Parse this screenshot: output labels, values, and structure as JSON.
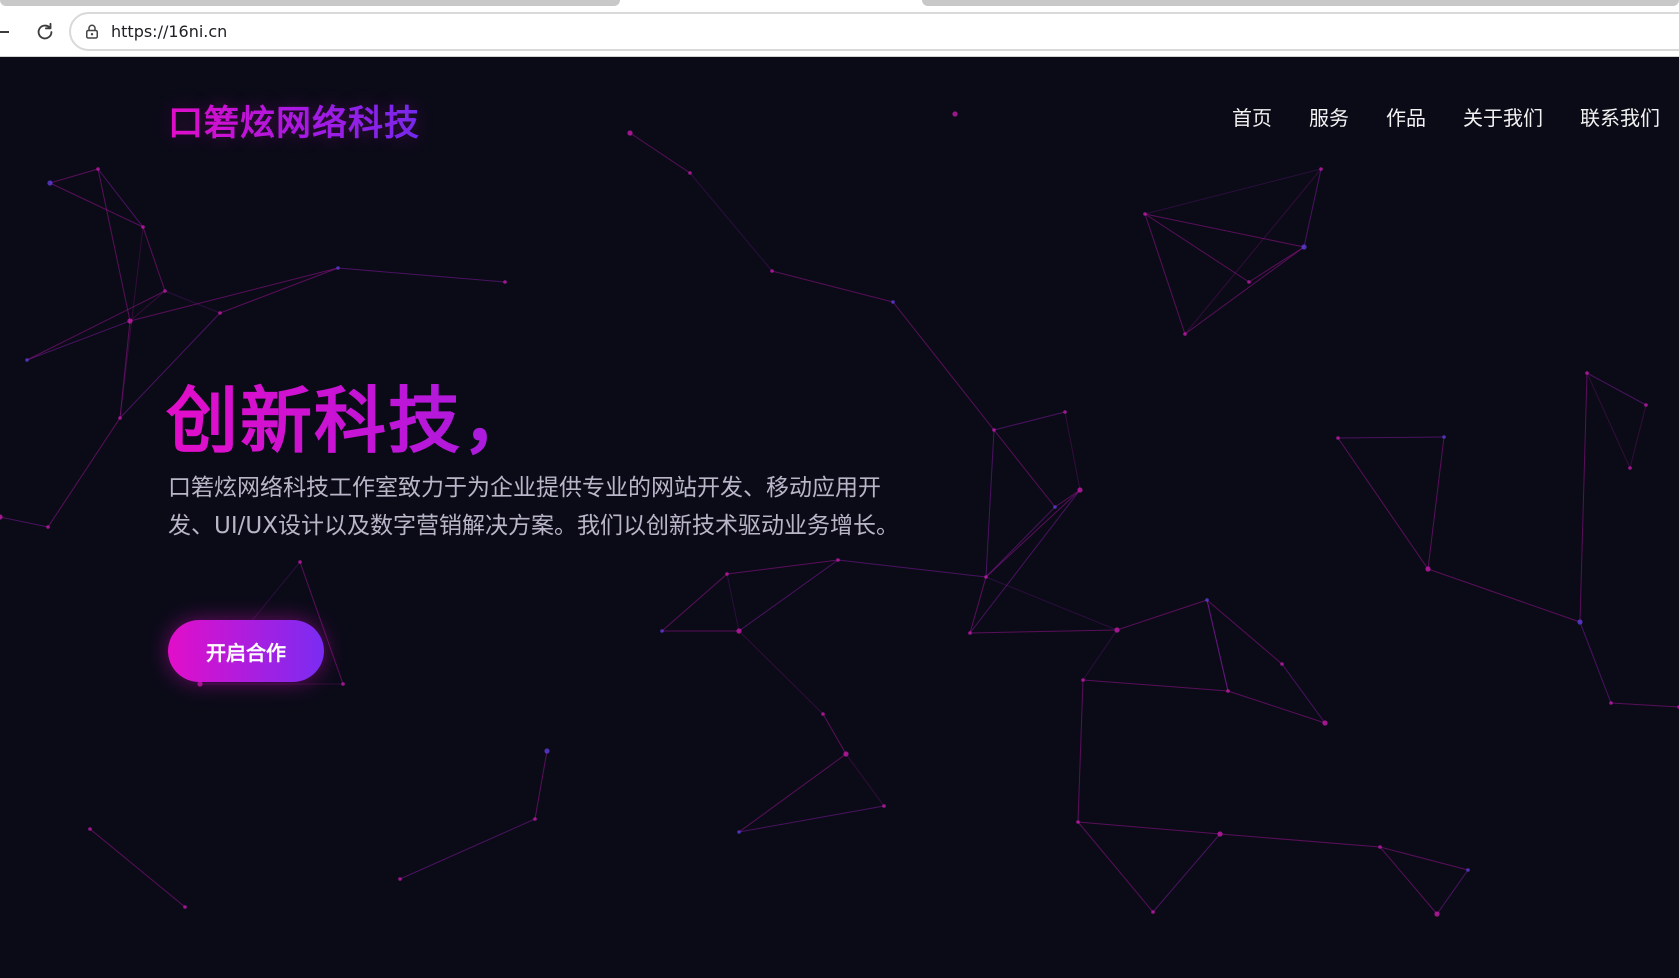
{
  "browser": {
    "url": "https://16ni.cn"
  },
  "site": {
    "brand": "口箬炫网络科技",
    "nav": [
      "首页",
      "服务",
      "作品",
      "关于我们",
      "联系我们"
    ]
  },
  "hero": {
    "title": "创新科技，",
    "description": "口箬炫网络科技工作室致力于为企业提供专业的网站开发、移动应用开发、UI/UX设计以及数字营销解决方案。我们以创新技术驱动业务增长。",
    "cta_label": "开启合作"
  },
  "colors": {
    "background": "#0b0b18",
    "accent_pink": "#e20ec9",
    "accent_purple": "#7a2cf2"
  },
  "icons": [
    "reload-icon",
    "site-info-icon"
  ]
}
